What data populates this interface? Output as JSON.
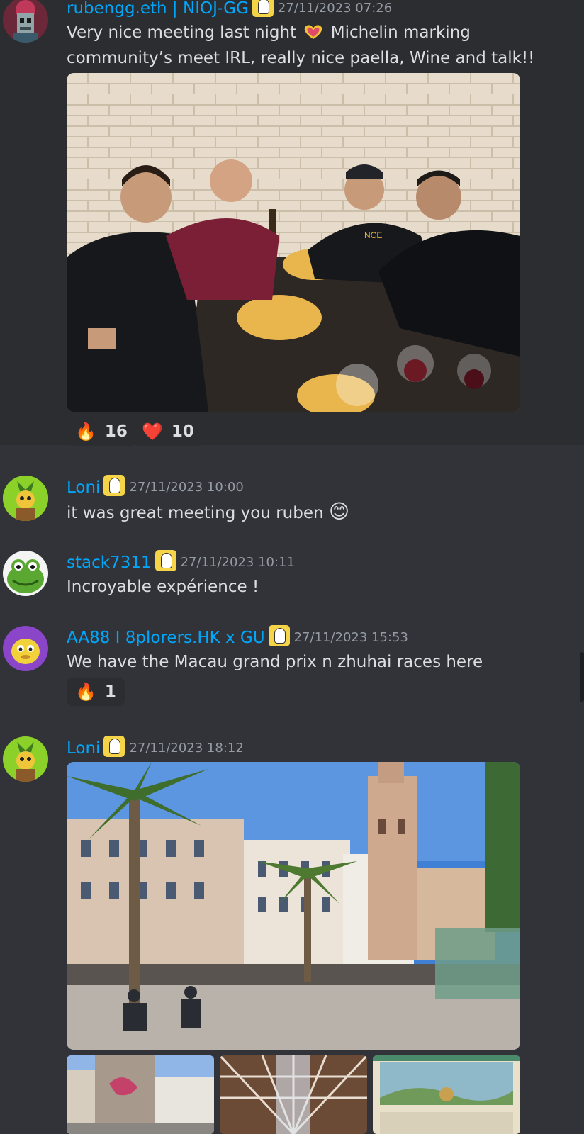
{
  "messages": [
    {
      "author": "rubengg.eth | NIOJ-GG",
      "timestamp": "27/11/2023 07:26",
      "text_before_emoji": "Very nice meeting last night",
      "emoji": "heart-hands",
      "text_after_emoji": "Michelin marking",
      "text_line2": "community’s meet IRL, really nice paella, Wine and talk!!",
      "reactions": [
        {
          "emoji": "🔥",
          "count": "16"
        },
        {
          "emoji": "❤️",
          "count": "10"
        }
      ]
    },
    {
      "author": "Loni",
      "timestamp": "27/11/2023 10:00",
      "text": "it was great meeting you ruben",
      "emoji": "😊"
    },
    {
      "author": "stack7311",
      "timestamp": "27/11/2023 10:11",
      "text": "Incroyable expérience !"
    },
    {
      "author": "AA88 I 8plorers.HK x GU",
      "timestamp": "27/11/2023 15:53",
      "text": "We have the Macau grand prix n zhuhai races here",
      "reactions": [
        {
          "emoji": "🔥",
          "count": "1"
        }
      ]
    },
    {
      "author": "Loni",
      "timestamp": "27/11/2023 18:12"
    }
  ],
  "colors": {
    "background": "#313338",
    "username": "#00a8fc",
    "timestamp": "#949ba4",
    "text": "#dbdee1",
    "reaction_bg": "#2b2d31"
  }
}
